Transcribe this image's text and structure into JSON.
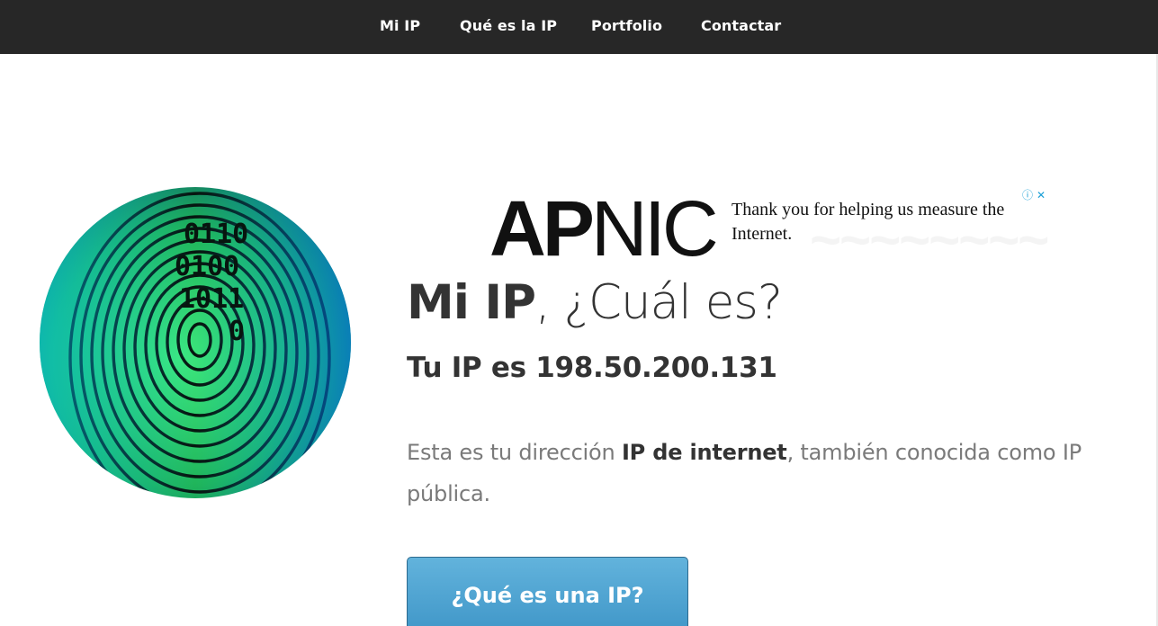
{
  "nav": {
    "items": [
      {
        "label": "Mi IP"
      },
      {
        "label": "Qué es la IP"
      },
      {
        "label": "Portfolio"
      },
      {
        "label": "Contactar"
      }
    ]
  },
  "hero_image": {
    "icon": "fingerprint-icon",
    "binary_rows": [
      "0110",
      "0100",
      "1011",
      "0"
    ]
  },
  "ad": {
    "logo_prefix": "AP",
    "logo_suffix": "NIC",
    "message": "Thank you for helping us measure the Internet.",
    "info_icon": "ⓘ",
    "close_icon": "✕"
  },
  "main": {
    "title_strong": "Mi IP",
    "title_rest": ", ¿Cuál es?",
    "ip_line": "Tu IP es 198.50.200.131",
    "description": {
      "before": "Esta es tu dirección ",
      "highlight": "IP de internet",
      "after": ", también conocida como IP pública."
    },
    "cta_label": "¿Qué es una IP?"
  },
  "colors": {
    "nav_bg": "#272727",
    "button_bg": "#4fa3d1",
    "fingerprint_green": "#2fd06a",
    "text_dark": "#333333",
    "text_muted": "#7a7a7a"
  }
}
